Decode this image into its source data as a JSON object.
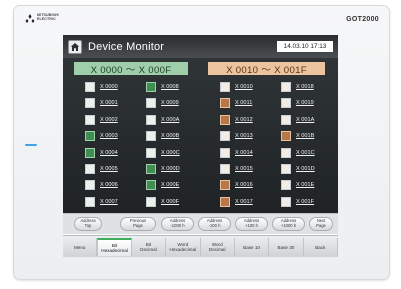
{
  "device": {
    "brand_line1": "MITSUBISHI",
    "brand_line2": "ELECTRIC",
    "model": "GOT2000"
  },
  "screen": {
    "title": "Device Monitor",
    "datetime": "14.03.10 17:13",
    "icons": {
      "home": "home-icon",
      "logo": "mitsubishi-diamonds-icon"
    }
  },
  "left_panel": {
    "range": "X 0000 ～ X 000F",
    "colors": {
      "header": "#9fceaa",
      "lamp_on": "#3f8f52",
      "lamp_off": "#e8f1ea"
    },
    "bits": [
      {
        "label": "X 0000",
        "on": false
      },
      {
        "label": "X 0008",
        "on": true
      },
      {
        "label": "X 0001",
        "on": false
      },
      {
        "label": "X 0009",
        "on": false
      },
      {
        "label": "X 0002",
        "on": false
      },
      {
        "label": "X 000A",
        "on": false
      },
      {
        "label": "X 0003",
        "on": true
      },
      {
        "label": "X 000B",
        "on": false
      },
      {
        "label": "X 0004",
        "on": true
      },
      {
        "label": "X 000C",
        "on": false
      },
      {
        "label": "X 0005",
        "on": false
      },
      {
        "label": "X 000D",
        "on": true
      },
      {
        "label": "X 0006",
        "on": false
      },
      {
        "label": "X 000E",
        "on": true
      },
      {
        "label": "X 0007",
        "on": false
      },
      {
        "label": "X 000F",
        "on": false
      }
    ]
  },
  "right_panel": {
    "range": "X 0010 ～ X 001F",
    "colors": {
      "header": "#ecc39f",
      "lamp_on": "#b97646",
      "lamp_off": "#f2ece7"
    },
    "bits": [
      {
        "label": "X 0010",
        "on": false
      },
      {
        "label": "X 0018",
        "on": false
      },
      {
        "label": "X 0011",
        "on": true
      },
      {
        "label": "X 0019",
        "on": false
      },
      {
        "label": "X 0012",
        "on": true
      },
      {
        "label": "X 001A",
        "on": false
      },
      {
        "label": "X 0013",
        "on": false
      },
      {
        "label": "X 001B",
        "on": true
      },
      {
        "label": "X 0014",
        "on": false
      },
      {
        "label": "X 001C",
        "on": false
      },
      {
        "label": "X 0015",
        "on": false
      },
      {
        "label": "X 001D",
        "on": false
      },
      {
        "label": "X 0016",
        "on": true
      },
      {
        "label": "X 001E",
        "on": false
      },
      {
        "label": "X 0017",
        "on": true
      },
      {
        "label": "X 001F",
        "on": false
      }
    ]
  },
  "nav_buttons": [
    "Address\nTop",
    "Previous\nPage",
    "Address\n-1000 h",
    "Address\n-100 h",
    "Address\n+100 h",
    "Address\n+1000 h",
    "Next\nPage"
  ],
  "tabs": [
    {
      "label": "Menu",
      "active": false
    },
    {
      "label": "Bit\nHexadecimal",
      "active": true
    },
    {
      "label": "Bit\nDecimal",
      "active": false
    },
    {
      "label": "Word\nHexadecimal",
      "active": false
    },
    {
      "label": "Word\nDecimal",
      "active": false
    },
    {
      "label": "Base 10",
      "active": false
    },
    {
      "label": "Base 30",
      "active": false
    },
    {
      "label": "Back",
      "active": false
    }
  ]
}
